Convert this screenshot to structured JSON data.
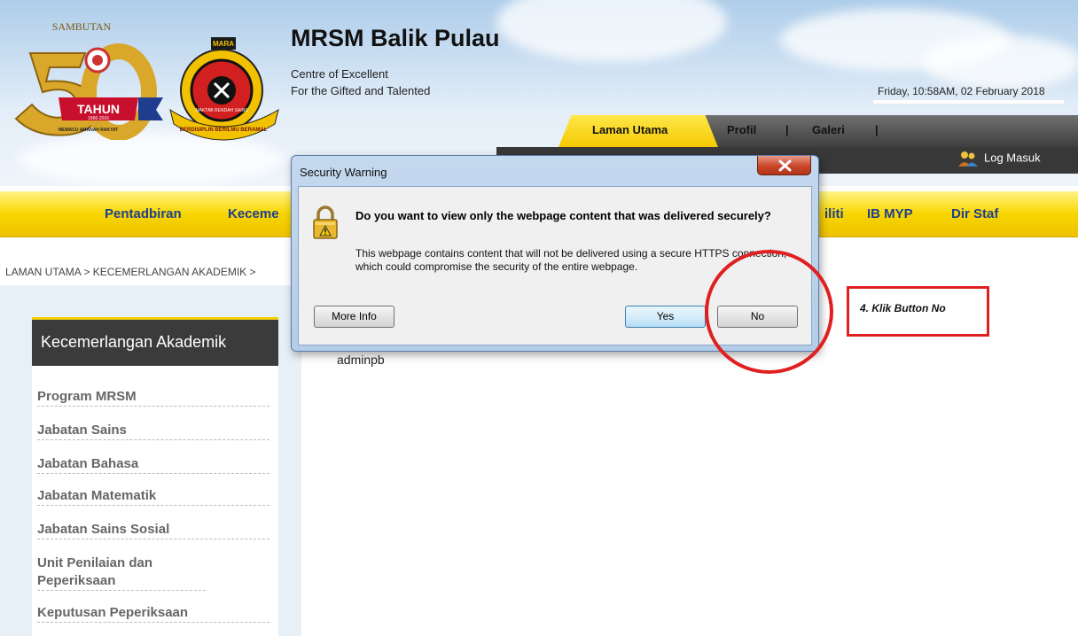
{
  "header": {
    "site_title": "MRSM Balik Pulau",
    "subtitle_line1": "Centre of Excellent",
    "subtitle_line2": "For the Gifted and Talented",
    "date": "Friday, 10:58AM, 02 February 2018",
    "logo_50": {
      "top_text": "SAMBUTAN",
      "badge": "TAHUN",
      "years": "1966-2016",
      "motto": "MEMACU AMANAH RAKYAT"
    },
    "logo_mara": {
      "top": "MARA",
      "ribbon": "BERDISIPLIN BERILMU BERAMAL",
      "inner": "MAKTAB RENDAH SAINS"
    }
  },
  "tabs": [
    {
      "label": "Laman Utama"
    },
    {
      "label": "Profil"
    },
    {
      "label": "Galeri"
    }
  ],
  "tab_separator": "|",
  "login": {
    "label": "Log Masuk"
  },
  "main_nav": [
    {
      "label": "Pentadbiran"
    },
    {
      "label": "Keceme"
    },
    {
      "label": "iliti"
    },
    {
      "label": "IB MYP"
    },
    {
      "label": "Dir Staf"
    }
  ],
  "breadcrumb": "LAMAN UTAMA > KECEMERLANGAN AKADEMIK >",
  "sidebar": {
    "title": "Kecemerlangan Akademik",
    "items": [
      {
        "label": "Program MRSM"
      },
      {
        "label": "Jabatan Sains"
      },
      {
        "label": "Jabatan Bahasa"
      },
      {
        "label": "Jabatan Matematik"
      },
      {
        "label": "Jabatan Sains Sosial"
      },
      {
        "label": "Unit Penilaian dan Peperiksaan"
      },
      {
        "label": "Keputusan Peperiksaan"
      }
    ]
  },
  "content": {
    "author": "adminpb"
  },
  "dialog": {
    "title": "Security Warning",
    "question": "Do you want to view only the webpage content that was delivered securely?",
    "message": "This webpage contains content that will not be delivered using a secure HTTPS connection, which could compromise the security of the entire webpage.",
    "buttons": {
      "more_info": "More Info",
      "yes": "Yes",
      "no": "No"
    }
  },
  "annotation": {
    "text": "4. Klik Button No",
    "color": "#e02020"
  },
  "colors": {
    "nav_yellow": "#f8d600",
    "nav_text": "#1f3f8f",
    "dark_bar": "#3b3b3b",
    "sidebar_accent": "#f3cf00"
  }
}
